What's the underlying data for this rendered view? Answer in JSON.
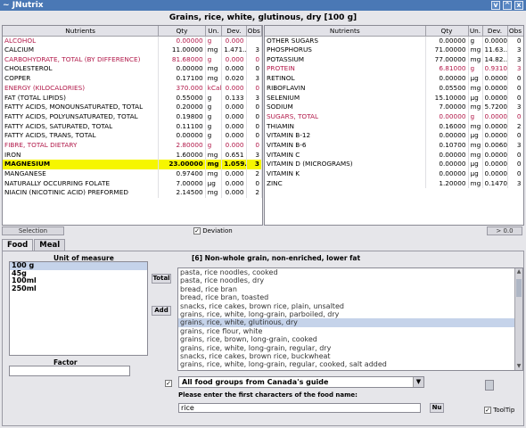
{
  "window": {
    "title": "JNutrix",
    "left_glyph": "~",
    "controls": [
      "v",
      "^",
      "x"
    ]
  },
  "food_title": "Grains, rice, white, glutinous, dry [100 g]",
  "columns": [
    "Nutrients",
    "Qty",
    "Un.",
    "Dev.",
    "Obs"
  ],
  "left_rows": [
    {
      "n": "ALCOHOL",
      "q": "0.00000",
      "u": "g",
      "d": "0.000",
      "o": "",
      "style": "red"
    },
    {
      "n": "CALCIUM",
      "q": "11.00000",
      "u": "mg",
      "d": "1.471...",
      "o": "3",
      "style": ""
    },
    {
      "n": "CARBOHYDRATE, TOTAL (BY DIFFERENCE)",
      "q": "81.68000",
      "u": "g",
      "d": "0.000",
      "o": "0",
      "style": "red"
    },
    {
      "n": "CHOLESTEROL",
      "q": "0.00000",
      "u": "mg",
      "d": "0.000",
      "o": "0",
      "style": ""
    },
    {
      "n": "COPPER",
      "q": "0.17100",
      "u": "mg",
      "d": "0.020",
      "o": "3",
      "style": ""
    },
    {
      "n": "ENERGY (KILOCALORIES)",
      "q": "370.000",
      "u": "kCal",
      "d": "0.000",
      "o": "0",
      "style": "red"
    },
    {
      "n": "FAT (TOTAL LIPIDS)",
      "q": "0.55000",
      "u": "g",
      "d": "0.133",
      "o": "3",
      "style": ""
    },
    {
      "n": "FATTY ACIDS, MONOUNSATURATED, TOTAL",
      "q": "0.20000",
      "u": "g",
      "d": "0.000",
      "o": "0",
      "style": ""
    },
    {
      "n": "FATTY ACIDS, POLYUNSATURATED, TOTAL",
      "q": "0.19800",
      "u": "g",
      "d": "0.000",
      "o": "0",
      "style": ""
    },
    {
      "n": "FATTY ACIDS, SATURATED, TOTAL",
      "q": "0.11100",
      "u": "g",
      "d": "0.000",
      "o": "0",
      "style": ""
    },
    {
      "n": "FATTY ACIDS, TRANS, TOTAL",
      "q": "0.00000",
      "u": "g",
      "d": "0.000",
      "o": "0",
      "style": ""
    },
    {
      "n": "FIBRE, TOTAL DIETARY",
      "q": "2.80000",
      "u": "g",
      "d": "0.000",
      "o": "0",
      "style": "red"
    },
    {
      "n": "IRON",
      "q": "1.60000",
      "u": "mg",
      "d": "0.651",
      "o": "3",
      "style": ""
    },
    {
      "n": "MAGNESIUM",
      "q": "23.00000",
      "u": "mg",
      "d": "1.059...",
      "o": "3",
      "style": "hl"
    },
    {
      "n": "MANGANESE",
      "q": "0.97400",
      "u": "mg",
      "d": "0.000",
      "o": "2",
      "style": ""
    },
    {
      "n": "NATURALLY OCCURRING FOLATE",
      "q": "7.00000",
      "u": "µg",
      "d": "0.000",
      "o": "0",
      "style": ""
    },
    {
      "n": "NIACIN (NICOTINIC ACID) PREFORMED",
      "q": "2.14500",
      "u": "mg",
      "d": "0.000",
      "o": "2",
      "style": ""
    }
  ],
  "right_rows": [
    {
      "n": "OTHER SUGARS",
      "q": "0.00000",
      "u": "g",
      "d": "0.00000",
      "o": "0",
      "style": ""
    },
    {
      "n": "PHOSPHORUS",
      "q": "71.00000",
      "u": "mg",
      "d": "11.63...",
      "o": "3",
      "style": ""
    },
    {
      "n": "POTASSIUM",
      "q": "77.00000",
      "u": "mg",
      "d": "14.82...",
      "o": "3",
      "style": ""
    },
    {
      "n": "PROTEIN",
      "q": "6.81000",
      "u": "g",
      "d": "0.93100",
      "o": "3",
      "style": "red"
    },
    {
      "n": "RETINOL",
      "q": "0.00000",
      "u": "µg",
      "d": "0.00000",
      "o": "0",
      "style": ""
    },
    {
      "n": "RIBOFLAVIN",
      "q": "0.05500",
      "u": "mg",
      "d": "0.00000",
      "o": "0",
      "style": ""
    },
    {
      "n": "SELENIUM",
      "q": "15.10000",
      "u": "µg",
      "d": "0.00000",
      "o": "0",
      "style": ""
    },
    {
      "n": "SODIUM",
      "q": "7.00000",
      "u": "mg",
      "d": "5.72000",
      "o": "3",
      "style": ""
    },
    {
      "n": "SUGARS, TOTAL",
      "q": "0.00000",
      "u": "g",
      "d": "0.00000",
      "o": "0",
      "style": "red"
    },
    {
      "n": "THIAMIN",
      "q": "0.16000",
      "u": "mg",
      "d": "0.00000",
      "o": "2",
      "style": ""
    },
    {
      "n": "VITAMIN B-12",
      "q": "0.00000",
      "u": "µg",
      "d": "0.00000",
      "o": "0",
      "style": ""
    },
    {
      "n": "VITAMIN B-6",
      "q": "0.10700",
      "u": "mg",
      "d": "0.00600",
      "o": "3",
      "style": ""
    },
    {
      "n": "VITAMIN C",
      "q": "0.00000",
      "u": "mg",
      "d": "0.00000",
      "o": "0",
      "style": ""
    },
    {
      "n": "VITAMIN D (MICROGRAMS)",
      "q": "0.00000",
      "u": "µg",
      "d": "0.00000",
      "o": "0",
      "style": ""
    },
    {
      "n": "VITAMIN K",
      "q": "0.00000",
      "u": "µg",
      "d": "0.00000",
      "o": "0",
      "style": ""
    },
    {
      "n": "ZINC",
      "q": "1.20000",
      "u": "mg",
      "d": "0.14700",
      "o": "3",
      "style": ""
    }
  ],
  "table_bar": {
    "selection_label": "Selection",
    "deviation_label": "Deviation",
    "deviation_checked": "✓",
    "zoom_label": "> 0.0"
  },
  "tabs": [
    "Food",
    "Meal"
  ],
  "units": {
    "label": "Unit of measure",
    "items": [
      "100 g",
      "45g",
      "100ml",
      "250ml"
    ],
    "selected": 0
  },
  "factor": {
    "label": "Factor",
    "value": ""
  },
  "buttons": {
    "total": "Total",
    "add": "Add",
    "nu": "Nu"
  },
  "food_group_title": "[6] Non-whole grain, non-enriched, lower fat",
  "foods": [
    "pasta, rice noodles, cooked",
    "pasta, rice noodles, dry",
    "bread, rice bran",
    "bread, rice bran, toasted",
    "snacks, rice cakes, brown rice, plain, unsalted",
    "grains, rice, white, long-grain, parboiled, dry",
    "grains, rice, white, glutinous, dry",
    "grains, rice flour, white",
    "grains, rice, brown, long-grain, cooked",
    "grains, rice, white, long-grain, regular, dry",
    "snacks, rice cakes, brown rice, buckwheat",
    "grains, rice, white, long-grain, regular, cooked, salt added"
  ],
  "foods_selected": 6,
  "group_select": {
    "checked": "✓",
    "value": "All food groups from Canada's guide",
    "arrow": "▼"
  },
  "search": {
    "label": "Please enter the first characters of the food name:",
    "value": "rice"
  },
  "tooltip": {
    "label": "ToolTip",
    "checked": "✓"
  },
  "scroll_arrows": {
    "up": "▲",
    "down": "▼"
  }
}
